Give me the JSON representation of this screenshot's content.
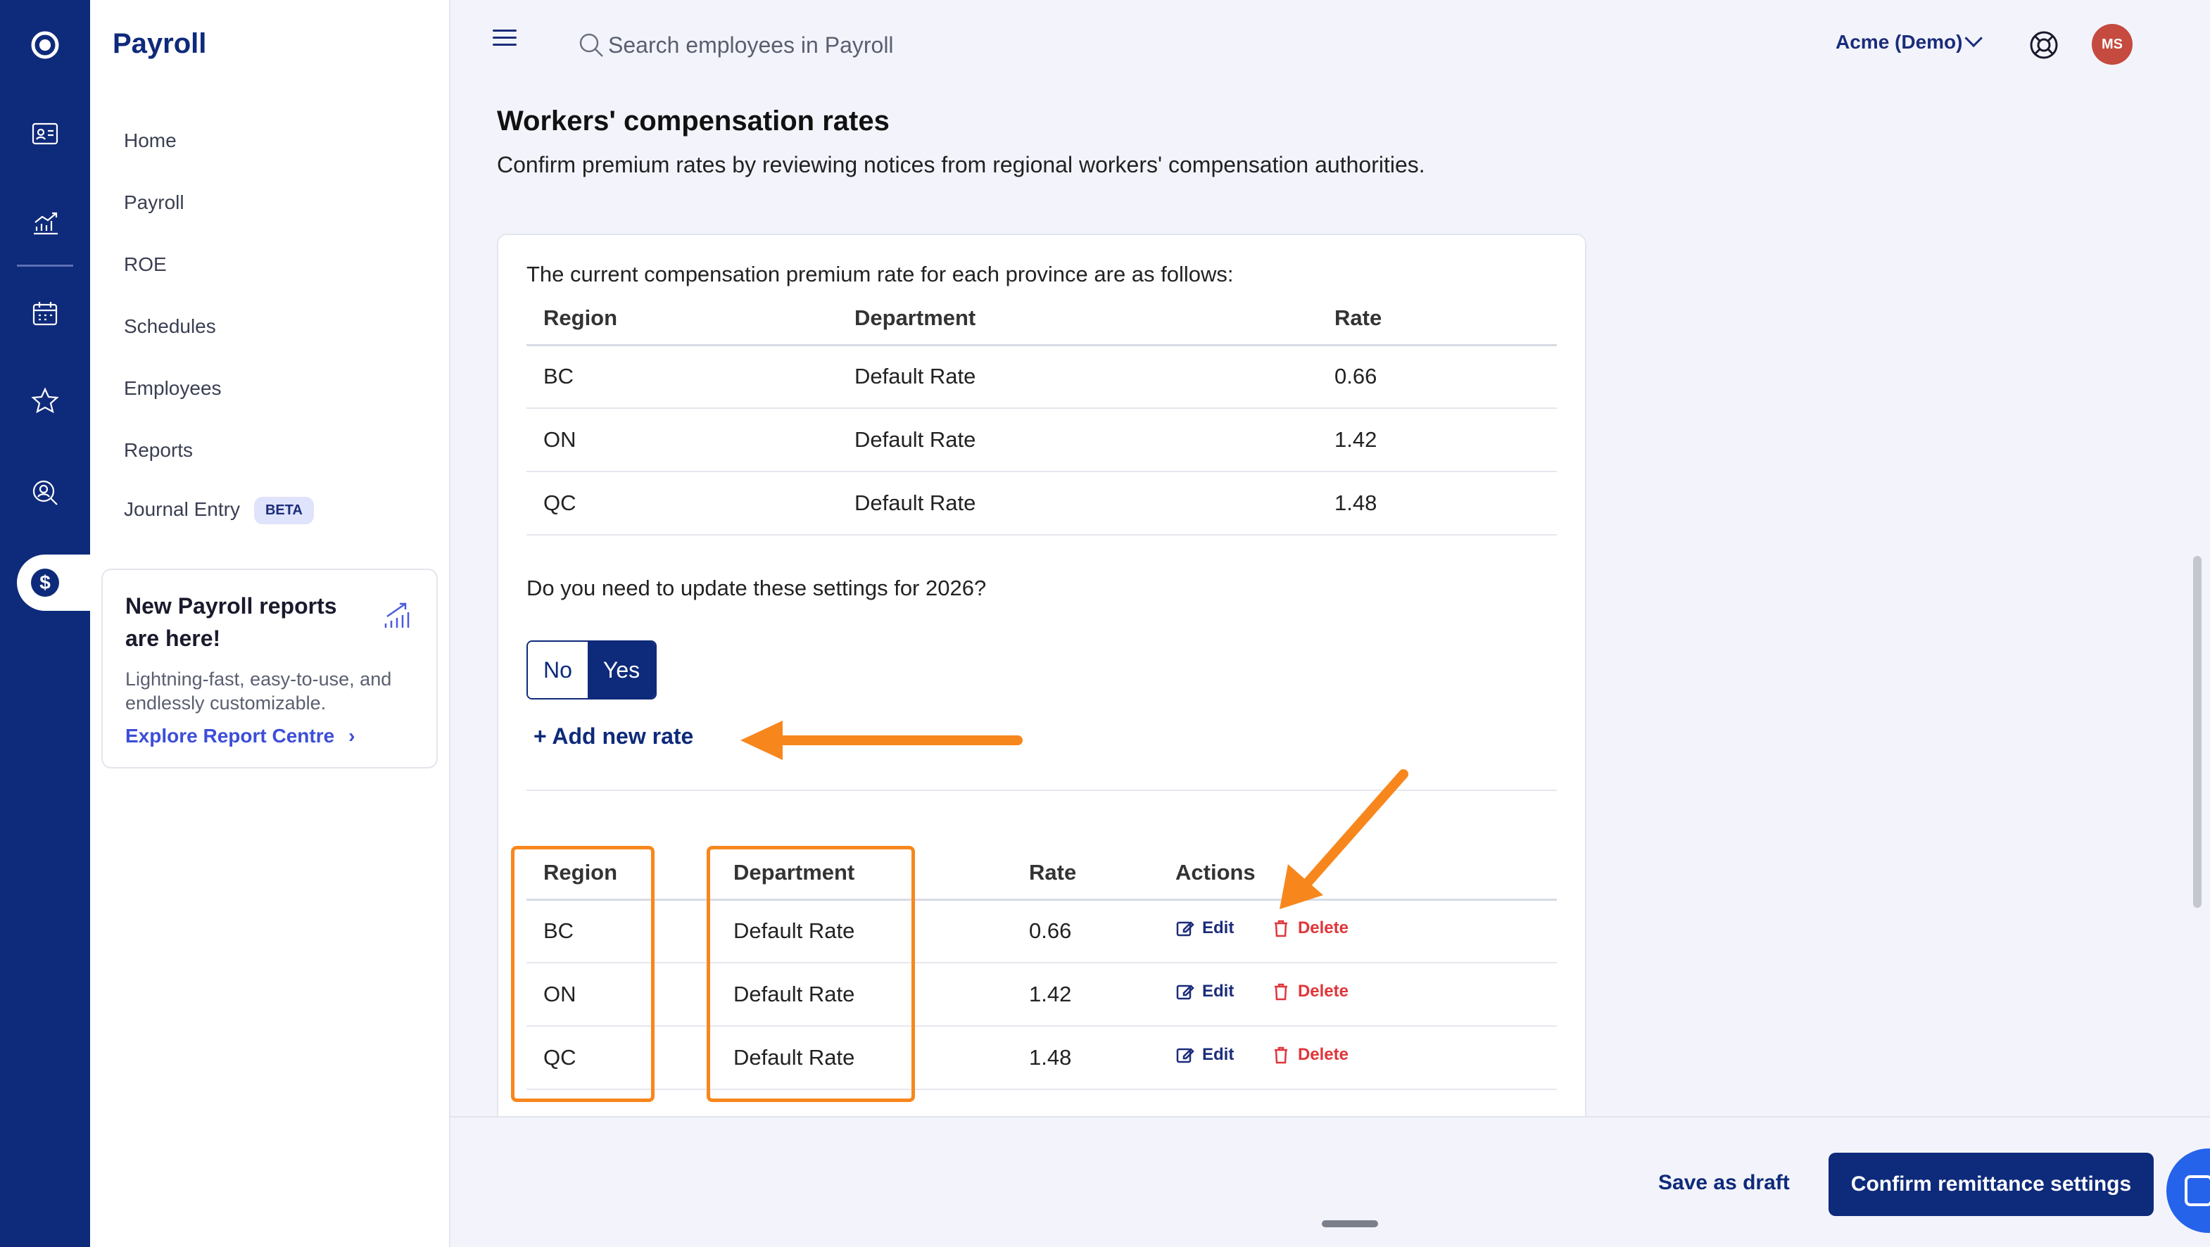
{
  "rail": {
    "icons": [
      "app-logo-icon",
      "id-card-icon",
      "chart-up-icon",
      "calendar-icon",
      "star-icon",
      "search-person-icon",
      "dollar-icon"
    ]
  },
  "sidebar": {
    "title": "Payroll",
    "items": [
      {
        "label": "Home"
      },
      {
        "label": "Payroll"
      },
      {
        "label": "ROE"
      },
      {
        "label": "Schedules"
      },
      {
        "label": "Employees"
      },
      {
        "label": "Reports"
      },
      {
        "label": "Journal Entry",
        "badge": "BETA"
      }
    ],
    "promo": {
      "title": "New Payroll reports are here!",
      "text": "Lightning-fast, easy-to-use, and endlessly customizable.",
      "link": "Explore Report Centre"
    }
  },
  "header": {
    "search_placeholder": "Search employees in Payroll",
    "company": "Acme (Demo)",
    "avatar_initials": "MS"
  },
  "main": {
    "title": "Workers' compensation rates",
    "subtitle": "Confirm premium rates by reviewing notices from regional workers' compensation authorities.",
    "intro": "The current compensation premium rate for each province are as follows:",
    "current_table": {
      "headers": [
        "Region",
        "Department",
        "Rate"
      ],
      "rows": [
        [
          "BC",
          "Default Rate",
          "0.66"
        ],
        [
          "ON",
          "Default Rate",
          "1.42"
        ],
        [
          "QC",
          "Default Rate",
          "1.48"
        ]
      ]
    },
    "question": "Do you need to update these settings for 2026?",
    "toggle": {
      "no": "No",
      "yes": "Yes",
      "selected": "Yes"
    },
    "add_rate": "+ Add new rate",
    "edit_table": {
      "headers": [
        "Region",
        "Department",
        "Rate",
        "Actions"
      ],
      "rows": [
        [
          "BC",
          "Default Rate",
          "0.66"
        ],
        [
          "ON",
          "Default Rate",
          "1.42"
        ],
        [
          "QC",
          "Default Rate",
          "1.48"
        ]
      ],
      "edit_label": "Edit",
      "delete_label": "Delete"
    }
  },
  "footer": {
    "save_draft": "Save as draft",
    "confirm": "Confirm remittance settings"
  },
  "colors": {
    "brand_navy": "#0e2a7a",
    "accent_blue": "#3d4ed8",
    "danger_red": "#e0363a",
    "annotation_orange": "#f7871d",
    "avatar_red": "#c54a3f"
  }
}
